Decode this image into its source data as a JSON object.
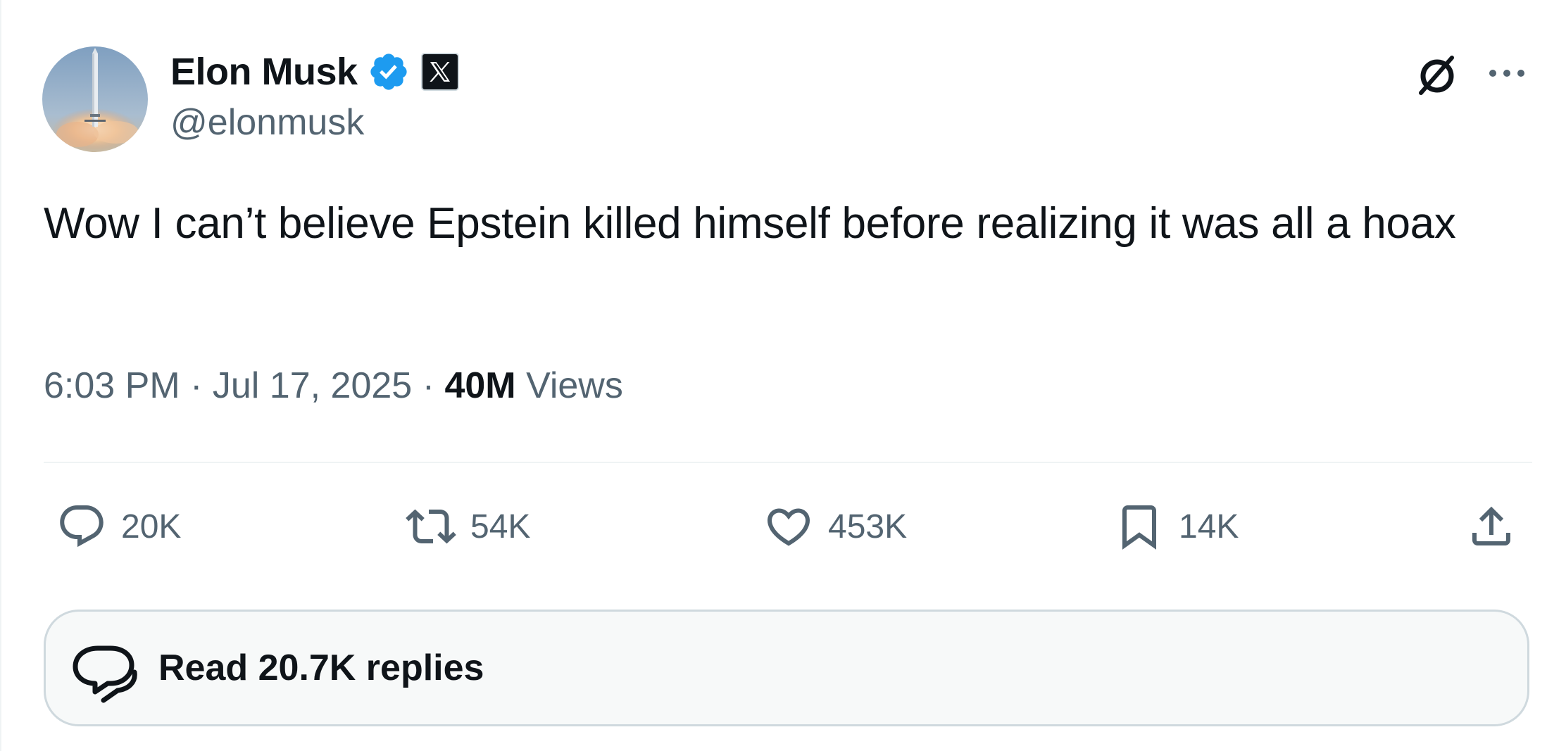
{
  "author": {
    "display_name": "Elon Musk",
    "handle": "@elonmusk",
    "verified_icon": "verified-badge-icon",
    "affiliation_icon": "x-logo-icon"
  },
  "tweet": {
    "text": "Wow I can’t believe Epstein killed himself before realizing it was all a hoax",
    "time": "6:03 PM",
    "separator": "·",
    "date": "Jul 17, 2025",
    "views_count": "40M",
    "views_label": "Views"
  },
  "actions": {
    "replies": "20K",
    "reposts": "54K",
    "likes": "453K",
    "bookmarks": "14K"
  },
  "read_replies": {
    "label": "Read 20.7K replies"
  },
  "colors": {
    "text": "#0f1419",
    "secondary": "#536471",
    "verified": "#1d9bf0",
    "divider": "#eff3f4",
    "pill_bg": "#f7f9f9",
    "pill_border": "#cfd9de"
  }
}
